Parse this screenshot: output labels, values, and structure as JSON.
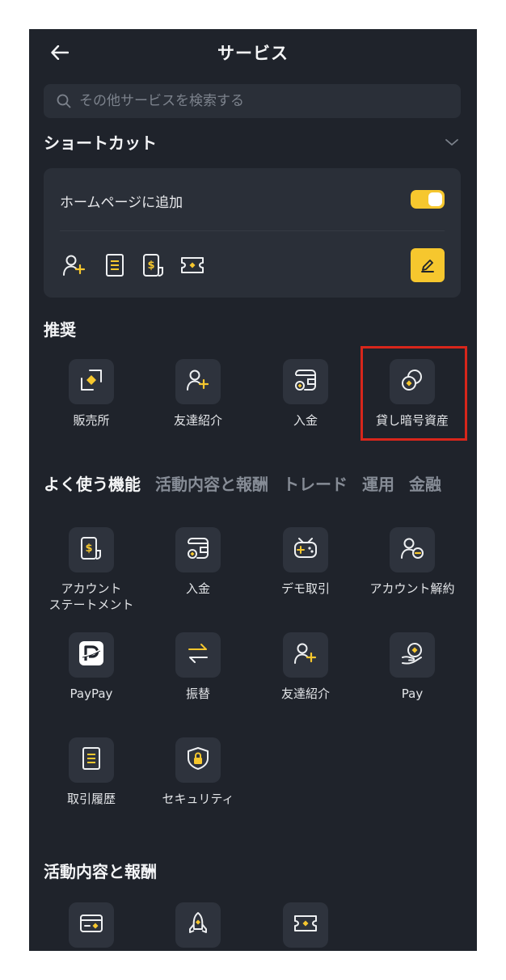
{
  "header": {
    "title": "サービス"
  },
  "search": {
    "placeholder": "その他サービスを検索する"
  },
  "shortcuts": {
    "title": "ショートカット",
    "add_to_home_label": "ホームページに追加",
    "toggle_on": true,
    "icons": [
      "add-friend-icon",
      "document-icon",
      "statement-icon",
      "ticket-icon"
    ]
  },
  "recommended": {
    "title": "推奨",
    "items": [
      {
        "label": "販売所",
        "icon": "exchange-icon"
      },
      {
        "label": "友達紹介",
        "icon": "add-friend-icon"
      },
      {
        "label": "入金",
        "icon": "deposit-icon"
      },
      {
        "label": "貸し暗号資産",
        "icon": "crypto-lending-icon"
      }
    ]
  },
  "tabs": [
    "よく使う機能",
    "活動内容と報酬",
    "トレード",
    "運用",
    "金融"
  ],
  "frequent": {
    "items": [
      {
        "label": "アカウント\nステートメント",
        "icon": "statement-icon"
      },
      {
        "label": "入金",
        "icon": "deposit-icon"
      },
      {
        "label": "デモ取引",
        "icon": "gamepad-icon"
      },
      {
        "label": "アカウント解約",
        "icon": "remove-user-icon"
      },
      {
        "label": "PayPay",
        "icon": "paypay-icon"
      },
      {
        "label": "振替",
        "icon": "transfer-icon"
      },
      {
        "label": "友達紹介",
        "icon": "add-friend-icon"
      },
      {
        "label": "Pay",
        "icon": "pay-icon"
      },
      {
        "label": "取引履歴",
        "icon": "document-icon"
      },
      {
        "label": "セキュリティ",
        "icon": "shield-lock-icon"
      }
    ]
  },
  "activity": {
    "title": "活動内容と報酬",
    "icons": [
      "card-icon",
      "rocket-icon",
      "ticket-icon"
    ]
  },
  "colors": {
    "accent": "#f6c72e",
    "background": "#1f232b",
    "highlight": "#d8261b"
  }
}
